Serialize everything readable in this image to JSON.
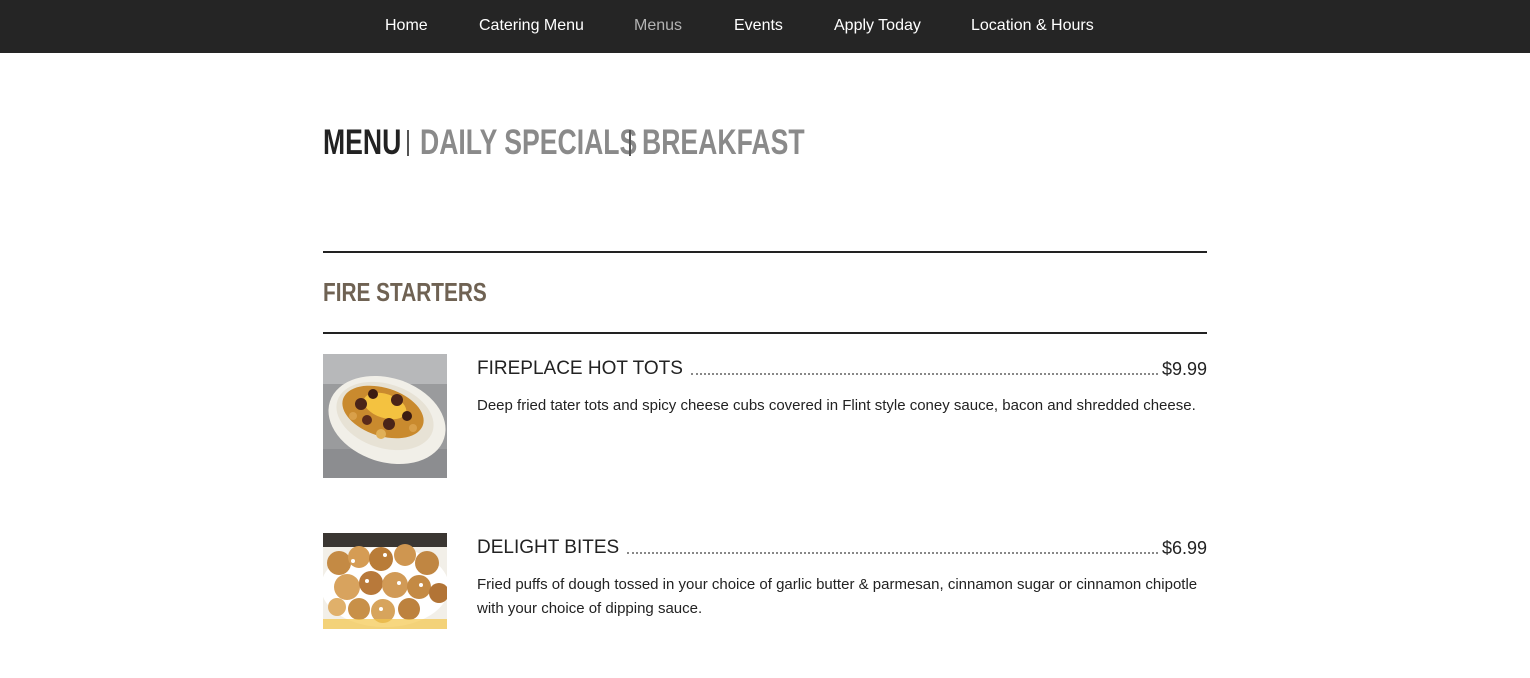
{
  "nav": {
    "items": [
      {
        "label": "Home",
        "active": false
      },
      {
        "label": "Catering Menu",
        "active": false
      },
      {
        "label": "Menus",
        "active": true
      },
      {
        "label": "Events",
        "active": false
      },
      {
        "label": "Apply Today",
        "active": false
      },
      {
        "label": "Location & Hours",
        "active": false
      }
    ]
  },
  "menu_tabs": {
    "items": [
      {
        "label": "MENU",
        "current": true
      },
      {
        "label": "DAILY SPECIALS",
        "current": false
      },
      {
        "label": "BREAKFAST",
        "current": false
      }
    ]
  },
  "section": {
    "title": "FIRE STARTERS",
    "items": [
      {
        "name": "FIREPLACE HOT TOTS",
        "price": "$9.99",
        "description": "Deep fried tater tots and spicy cheese cubs covered in Flint style coney sauce, bacon and shredded cheese.",
        "photo": "hot-tots-photo"
      },
      {
        "name": "DELIGHT BITES",
        "price": "$6.99",
        "description": "Fried puffs of dough tossed in your choice of garlic butter & parmesan, cinnamon sugar or cinnamon chipotle with your choice of dipping sauce.",
        "photo": "delight-bites-photo"
      }
    ]
  },
  "colors": {
    "nav_bg": "#252525",
    "nav_text": "#ffffff",
    "nav_active": "#b3b3b3",
    "section_title": "#6f6253",
    "tab_inactive": "#8a8a8a"
  }
}
